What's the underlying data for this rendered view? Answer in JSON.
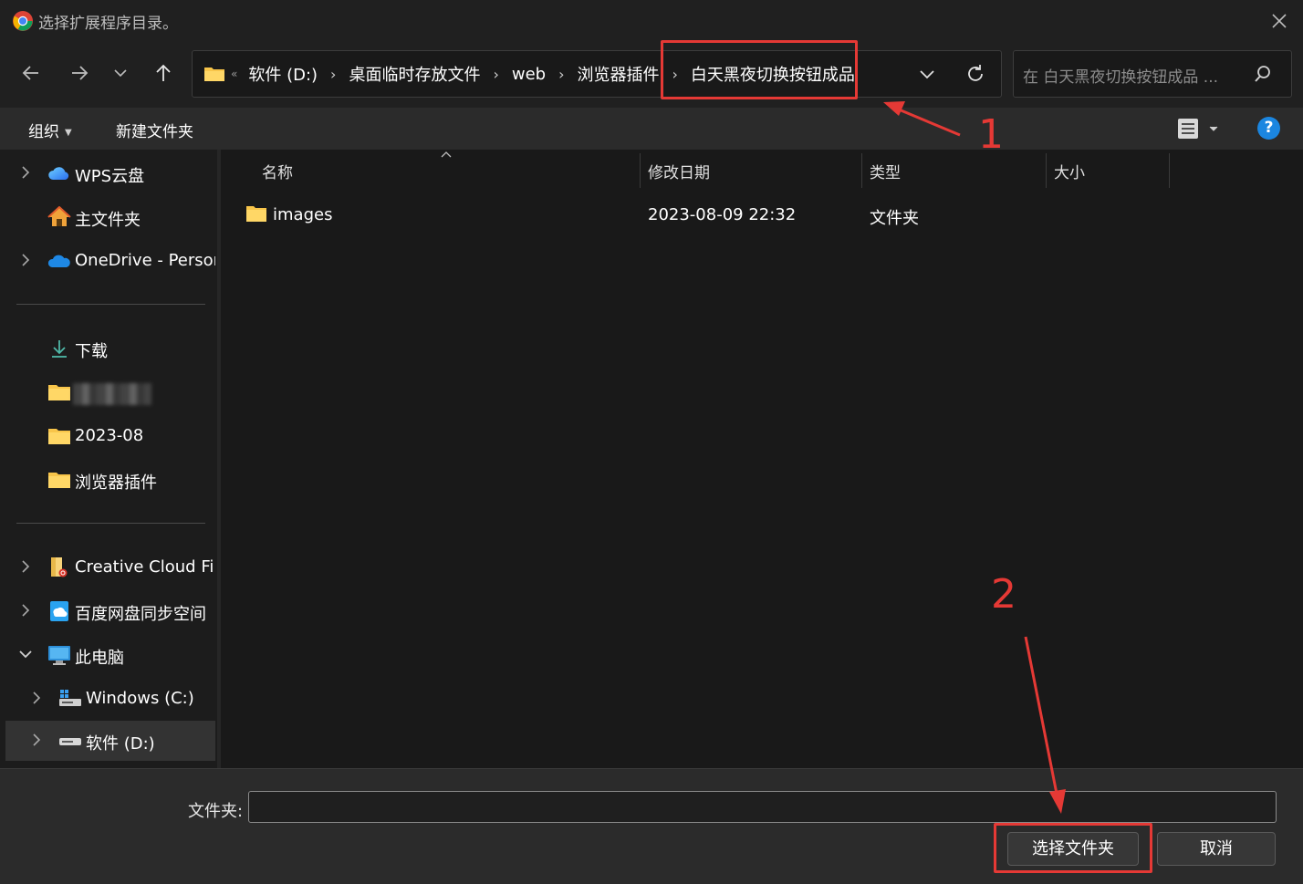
{
  "window": {
    "title": "选择扩展程序目录。"
  },
  "nav": {
    "breadcrumbs": [
      "软件 (D:)",
      "桌面临时存放文件",
      "web",
      "浏览器插件"
    ],
    "current": "白天黑夜切换按钮成品",
    "overflow": "«",
    "search_placeholder": "在 白天黑夜切换按钮成品 ..."
  },
  "toolbar": {
    "organize": "组织",
    "new_folder": "新建文件夹",
    "help": "?"
  },
  "sidebar": {
    "items": [
      {
        "label": "WPS云盘",
        "icon": "wps-cloud-icon"
      },
      {
        "label": "主文件夹",
        "icon": "home-icon"
      },
      {
        "label": "OneDrive - Person",
        "icon": "onedrive-icon"
      },
      {
        "label": "下载",
        "icon": "download-icon"
      },
      {
        "label": "",
        "icon": "folder-icon"
      },
      {
        "label": "2023-08",
        "icon": "folder-icon"
      },
      {
        "label": "浏览器插件",
        "icon": "folder-icon"
      },
      {
        "label": "Creative Cloud Files",
        "icon": "creative-cloud-icon"
      },
      {
        "label": "百度网盘同步空间",
        "icon": "baidu-netdisk-icon"
      },
      {
        "label": "此电脑",
        "icon": "computer-icon"
      },
      {
        "label": "Windows (C:)",
        "icon": "windows-drive-icon"
      },
      {
        "label": "软件 (D:)",
        "icon": "drive-icon"
      }
    ]
  },
  "filelist": {
    "columns": [
      "名称",
      "修改日期",
      "类型",
      "大小"
    ],
    "rows": [
      {
        "name": "images",
        "modified": "2023-08-09 22:32",
        "type": "文件夹",
        "size": "",
        "icon": "folder-icon"
      }
    ]
  },
  "footer": {
    "folder_label": "文件夹:",
    "folder_value": "",
    "select_button": "选择文件夹",
    "cancel_button": "取消"
  },
  "annotations": {
    "marker_1": "1",
    "marker_2": "2",
    "color": "#e53935"
  }
}
